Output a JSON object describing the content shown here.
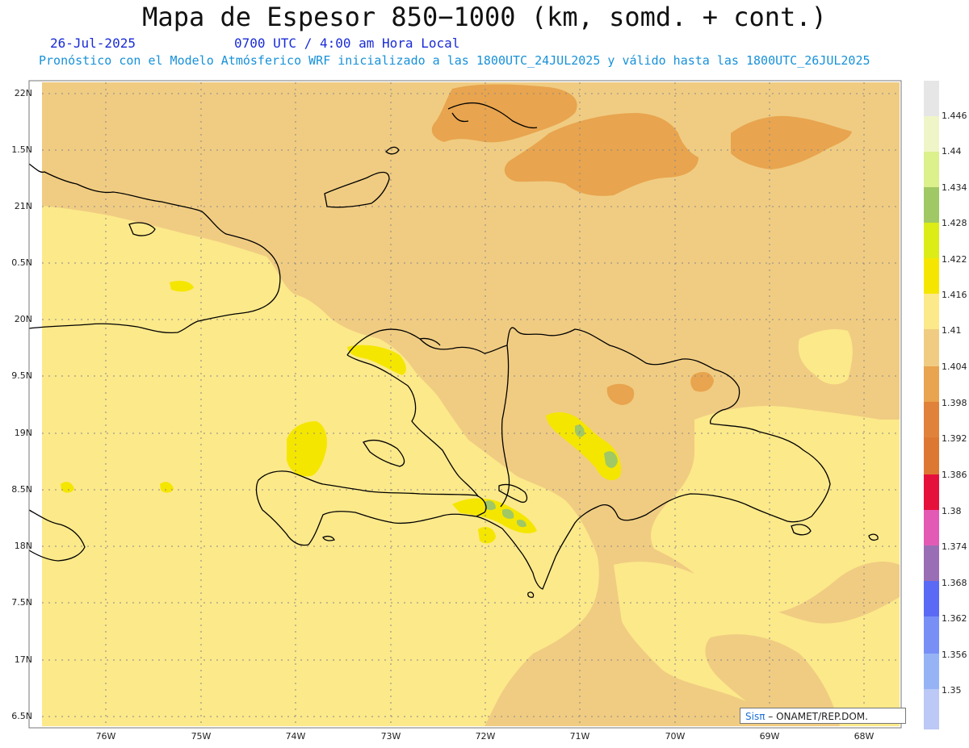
{
  "header": {
    "title": "Mapa de Espesor 850−1000 (km, somd. + cont.)",
    "date": "26-Jul-2025",
    "time": "0700 UTC / 4:00 am Hora Local",
    "description": "Pronóstico con el Modelo Atmósferico WRF inicializado a las 1800UTC_24JUL2025 y válido hasta las  1800UTC_26JUL2025"
  },
  "axes": {
    "lat_labels": [
      "22N",
      "1.5N",
      "21N",
      "0.5N",
      "20N",
      "9.5N",
      "19N",
      "8.5N",
      "18N",
      "7.5N",
      "17N",
      "6.5N"
    ],
    "lon_labels": [
      "76W",
      "75W",
      "74W",
      "73W",
      "72W",
      "71W",
      "70W",
      "69W",
      "68W"
    ]
  },
  "legend": {
    "labels": [
      "1.446",
      "1.44",
      "1.434",
      "1.428",
      "1.422",
      "1.416",
      "1.41",
      "1.404",
      "1.398",
      "1.392",
      "1.386",
      "1.38",
      "1.374",
      "1.368",
      "1.362",
      "1.356",
      "1.35"
    ],
    "colors": [
      "#e6e6e6",
      "#f0f5c8",
      "#dcf08c",
      "#a0c864",
      "#dcec16",
      "#f5e600",
      "#fce98a",
      "#f0cc82",
      "#e8a44e",
      "#e1823a",
      "#dc7832",
      "#e6103c",
      "#e35ab4",
      "#9a6eb4",
      "#5a6af5",
      "#7890f5",
      "#96b4f5",
      "#bcc8f5"
    ]
  },
  "credit": {
    "brand": "Sisπ",
    "text": "– ONAMET/REP.DOM."
  },
  "map_colors": {
    "background": "#f0cc82",
    "yellow": "#fce98a",
    "orange": "#e8a44e",
    "bright_yellow": "#f5e600",
    "green": "#a0c864"
  }
}
